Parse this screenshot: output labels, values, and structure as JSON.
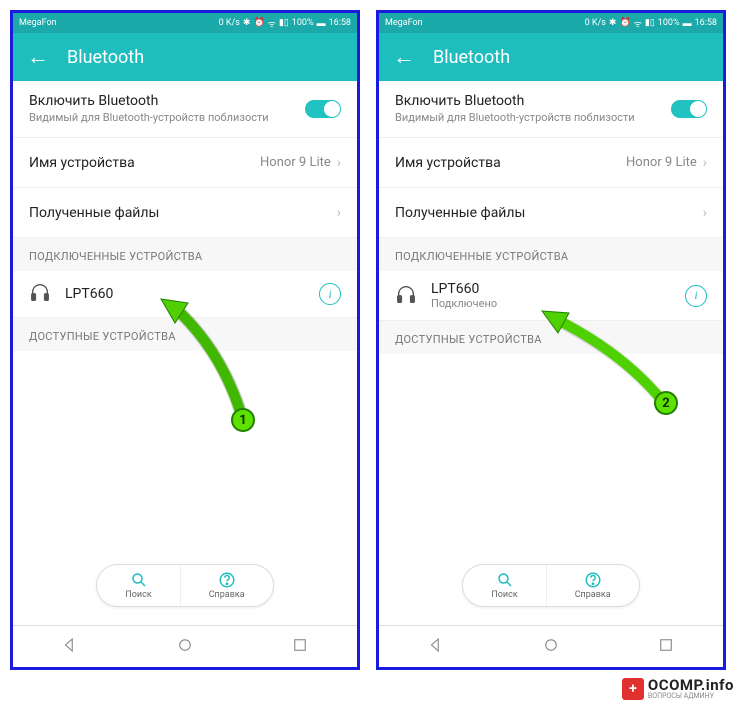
{
  "statusbar": {
    "carrier": "MegaFon",
    "speed": "0 K/s",
    "battery": "100%",
    "time": "16:58"
  },
  "header": {
    "title": "Bluetooth"
  },
  "enable": {
    "title": "Включить Bluetooth",
    "sub": "Видимый для Bluetooth-устройств поблизости"
  },
  "deviceName": {
    "label": "Имя устройства",
    "value": "Honor 9 Lite"
  },
  "receivedFiles": {
    "label": "Полученные файлы"
  },
  "sections": {
    "connected": "ПОДКЛЮЧЕННЫЕ УСТРОЙСТВА",
    "available": "ДОСТУПНЫЕ УСТРОЙСТВА"
  },
  "device": {
    "name": "LPT660",
    "status": "Подключено"
  },
  "buttons": {
    "search": "Поиск",
    "help": "Справка"
  },
  "watermark": {
    "main": "OCOMP.info",
    "sub": "ВОПРОСЫ АДМИНУ"
  },
  "badges": {
    "one": "1",
    "two": "2"
  }
}
